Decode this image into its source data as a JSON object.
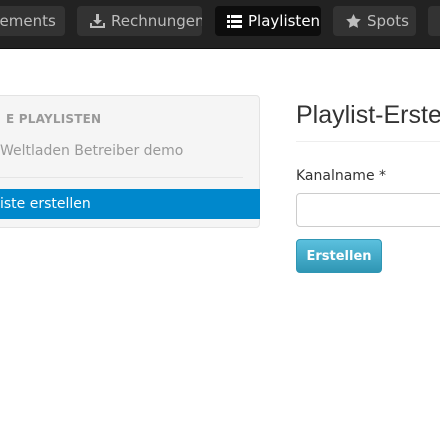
{
  "nav": {
    "tabs": [
      {
        "label": "nements",
        "icon": "none"
      },
      {
        "label": "Rechnungen",
        "icon": "download-icon"
      },
      {
        "label": "Playlisten",
        "icon": "list-icon",
        "active": true
      },
      {
        "label": "Spots",
        "icon": "star-icon"
      }
    ]
  },
  "sidebar": {
    "header": "E PLAYLISTEN",
    "link": "Weltladen Betreiber demo",
    "active_item": "iste erstellen"
  },
  "main": {
    "title": "Playlist-Erste",
    "channel_label": "Kanalname *",
    "channel_value": "",
    "submit_label": "Erstellen"
  },
  "colors": {
    "nav_bg": "#222222",
    "accent": "#0088cc",
    "button": "#49afcd"
  }
}
